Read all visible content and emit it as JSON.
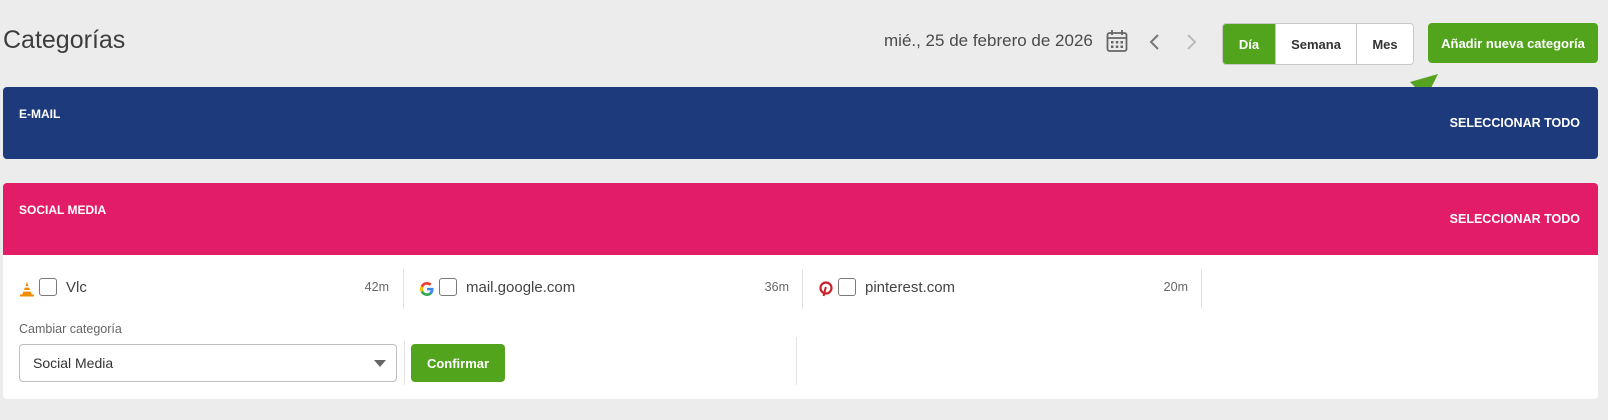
{
  "header": {
    "title": "Categorías",
    "date": "mié., 25 de febrero de 2026",
    "icons": {
      "calendar": "calendar-icon",
      "prev": "chevron-left-icon",
      "next": "chevron-right-icon"
    },
    "view_toggle": [
      {
        "label": "Día",
        "active": true
      },
      {
        "label": "Semana",
        "active": false
      },
      {
        "label": "Mes",
        "active": false
      }
    ],
    "add_button": "Añadir nueva categoría"
  },
  "colors": {
    "accent_green": "#52a41c",
    "email_banner": "#1d3b7c",
    "social_banner": "#e31c68",
    "annotation_arrow": "#55a321"
  },
  "categories": [
    {
      "name": "E-MAIL",
      "select_all": "SELECCIONAR TODO"
    },
    {
      "name": "SOCIAL MEDIA",
      "select_all": "SELECCIONAR TODO"
    }
  ],
  "social_apps": [
    {
      "icon": "vlc-cone-icon",
      "name": "Vlc",
      "time": "42m",
      "checked": false
    },
    {
      "icon": "google-g-icon",
      "name": "mail.google.com",
      "time": "36m",
      "checked": false
    },
    {
      "icon": "pinterest-icon",
      "name": "pinterest.com",
      "time": "20m",
      "checked": false
    }
  ],
  "change_category": {
    "label": "Cambiar categoría",
    "selected": "Social Media",
    "confirm": "Confirmar"
  }
}
